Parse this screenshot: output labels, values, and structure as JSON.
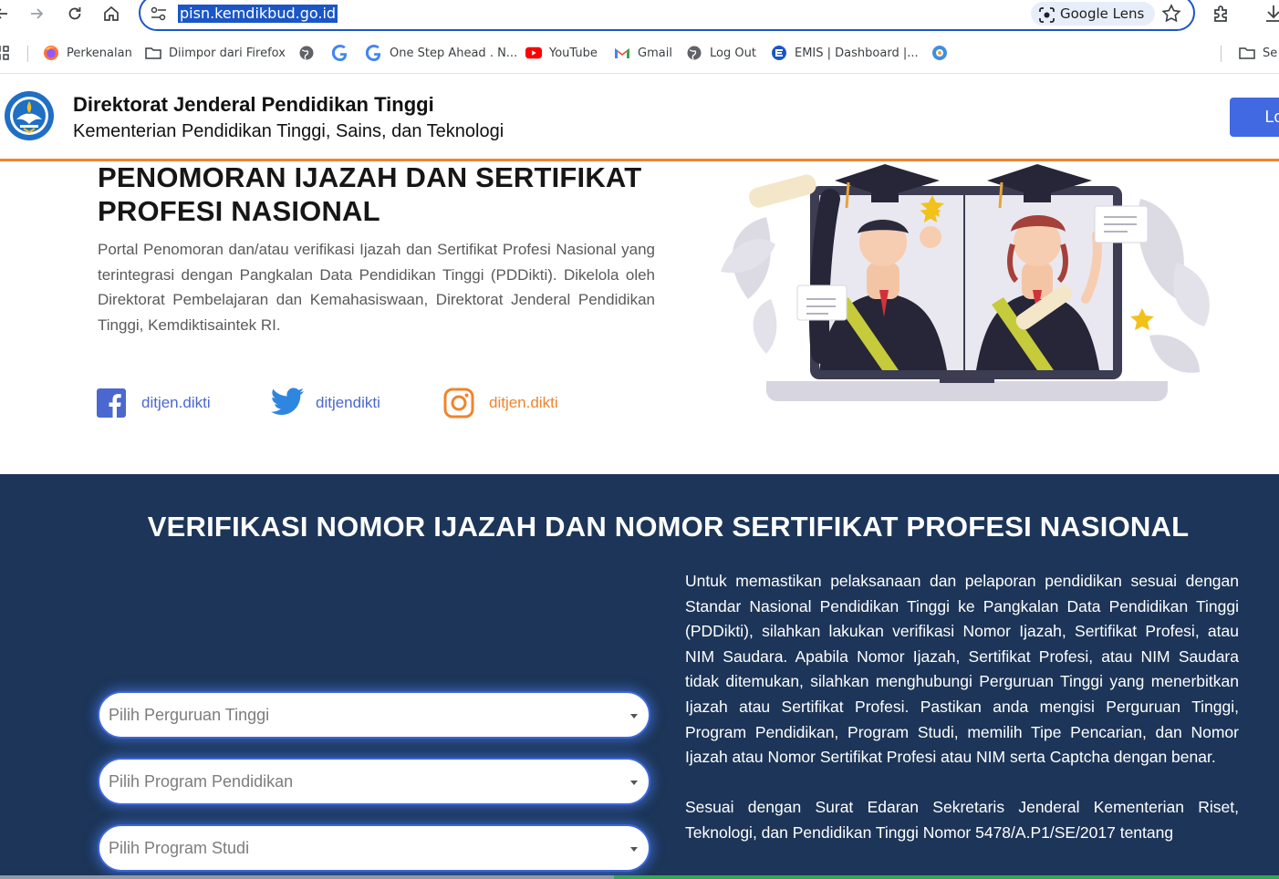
{
  "browser": {
    "url": "pisn.kemdikbud.go.id",
    "lens_label": "Google Lens",
    "bookmarks": [
      {
        "label": "Perkenalan",
        "icon": "firefox-icon"
      },
      {
        "label": "Diimpor dari Firefox",
        "icon": "folder-icon"
      },
      {
        "label": "",
        "icon": "globe-icon"
      },
      {
        "label": "",
        "icon": "google-icon"
      },
      {
        "label": "One Step Ahead . N...",
        "icon": "google-icon"
      },
      {
        "label": "YouTube",
        "icon": "youtube-icon"
      },
      {
        "label": "Gmail",
        "icon": "gmail-icon"
      },
      {
        "label": "Log Out",
        "icon": "globe-icon"
      },
      {
        "label": "EMIS | Dashboard |...",
        "icon": "emis-icon"
      },
      {
        "label": "",
        "icon": "app-icon"
      }
    ],
    "bookmark_folder_right": "Se",
    "colors": {
      "accent": "#1a56c6"
    }
  },
  "header": {
    "org_name": "Direktorat Jenderal Pendidikan Tinggi",
    "org_sub": "Kementerian Pendidikan Tinggi, Sains, dan Teknologi",
    "login_label": "Log",
    "colors": {
      "accent_border": "#f0842c",
      "button": "#4169e1"
    }
  },
  "hero": {
    "title": "PENOMORAN IJAZAH DAN SERTIFIKAT PROFESI NASIONAL",
    "description": "Portal Penomoran dan/atau verifikasi Ijazah dan Sertifikat Profesi Nasional yang terintegrasi dengan Pangkalan Data Pendidikan Tinggi (PDDikti). Dikelola oleh Direktorat Pembelajaran dan Kemahasiswaan, Direktorat Jenderal Pendidikan Tinggi, Kemdiktisaintek RI.",
    "social": [
      {
        "icon": "facebook-icon",
        "handle": "ditjen.dikti"
      },
      {
        "icon": "twitter-icon",
        "handle": "ditjendikti"
      },
      {
        "icon": "instagram-icon",
        "handle": "ditjen.dikti"
      }
    ]
  },
  "verification": {
    "title": "VERIFIKASI NOMOR IJAZAH DAN NOMOR SERTIFIKAT PROFESI NASIONAL",
    "selects": [
      {
        "placeholder": "Pilih Perguruan Tinggi"
      },
      {
        "placeholder": "Pilih Program Pendidikan"
      },
      {
        "placeholder": "Pilih Program Studi"
      }
    ],
    "paragraphs": [
      "Untuk memastikan pelaksanaan dan pelaporan pendidikan sesuai dengan Standar Nasional Pendidikan Tinggi ke Pangkalan Data Pendidikan Tinggi (PDDikti), silahkan lakukan verifikasi Nomor Ijazah, Sertifikat Profesi, atau NIM Saudara. Apabila Nomor Ijazah, Sertifikat Profesi, atau NIM Saudara tidak ditemukan, silahkan menghubungi Perguruan Tinggi yang menerbitkan Ijazah atau Sertifikat Profesi. Pastikan anda mengisi Perguruan Tinggi, Program Pendidikan, Program Studi, memilih Tipe Pencarian, dan Nomor Ijazah atau Nomor Sertifikat Profesi atau NIM serta Captcha dengan benar.",
      "Sesuai dengan Surat Edaran Sekretaris Jenderal Kementerian Riset, Teknologi, dan Pendidikan Tinggi Nomor 5478/A.P1/SE/2017 tentang"
    ],
    "colors": {
      "background": "#1c3558",
      "select_border": "#3d66d8"
    }
  }
}
